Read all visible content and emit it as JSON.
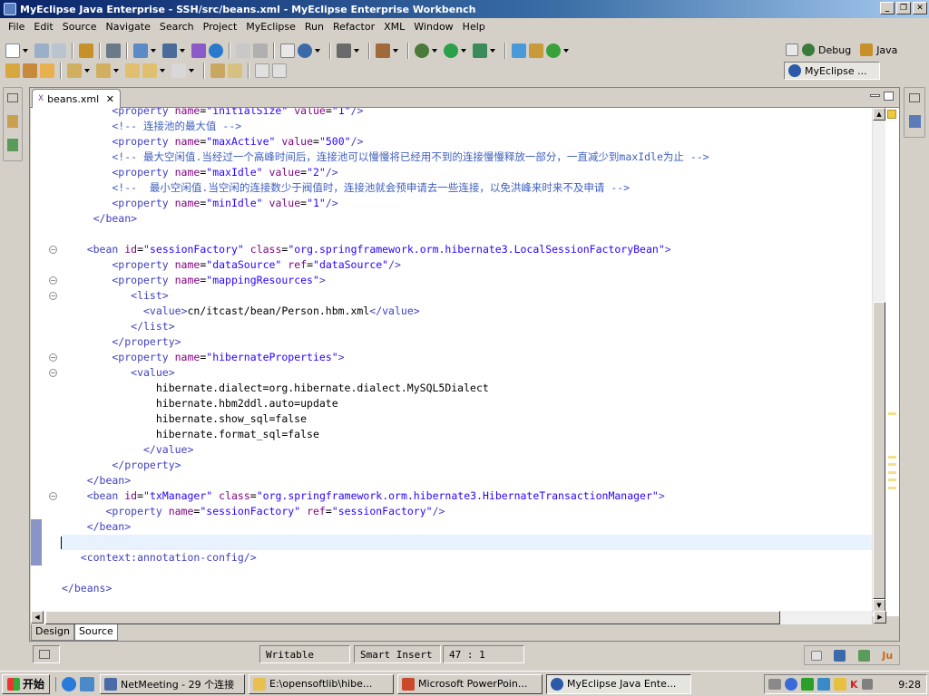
{
  "window": {
    "title": "MyEclipse Java Enterprise - SSH/src/beans.xml - MyEclipse Enterprise Workbench"
  },
  "menu": [
    "File",
    "Edit",
    "Source",
    "Navigate",
    "Search",
    "Project",
    "MyEclipse",
    "Run",
    "Refactor",
    "XML",
    "Window",
    "Help"
  ],
  "perspectives": {
    "debug": "Debug",
    "java": "Java",
    "myeclipse": "MyEclipse ..."
  },
  "editor": {
    "tab_label": "beans.xml",
    "bottom_tabs": [
      "Design",
      "Source"
    ],
    "lines": [
      {
        "fold": false,
        "segs": [
          {
            "c": "tg",
            "t": "        <property "
          },
          {
            "c": "at",
            "t": "name"
          },
          {
            "c": "tx",
            "t": "="
          },
          {
            "c": "av",
            "t": "\"initialSize\""
          },
          {
            "c": "tx",
            "t": " "
          },
          {
            "c": "at",
            "t": "value"
          },
          {
            "c": "tx",
            "t": "="
          },
          {
            "c": "av",
            "t": "\"1\""
          },
          {
            "c": "tg",
            "t": "/>"
          }
        ]
      },
      {
        "fold": false,
        "segs": [
          {
            "c": "cm",
            "t": "        <!-- 连接池的最大值 -->"
          }
        ]
      },
      {
        "fold": false,
        "segs": [
          {
            "c": "tg",
            "t": "        <property "
          },
          {
            "c": "at",
            "t": "name"
          },
          {
            "c": "tx",
            "t": "="
          },
          {
            "c": "av",
            "t": "\"maxActive\""
          },
          {
            "c": "tx",
            "t": " "
          },
          {
            "c": "at",
            "t": "value"
          },
          {
            "c": "tx",
            "t": "="
          },
          {
            "c": "av",
            "t": "\"500\""
          },
          {
            "c": "tg",
            "t": "/>"
          }
        ]
      },
      {
        "fold": false,
        "segs": [
          {
            "c": "cm",
            "t": "        <!-- 最大空闲值.当经过一个高峰时间后，连接池可以慢慢将已经用不到的连接慢慢释放一部分，一直减少到maxIdle为止 -->"
          }
        ]
      },
      {
        "fold": false,
        "segs": [
          {
            "c": "tg",
            "t": "        <property "
          },
          {
            "c": "at",
            "t": "name"
          },
          {
            "c": "tx",
            "t": "="
          },
          {
            "c": "av",
            "t": "\"maxIdle\""
          },
          {
            "c": "tx",
            "t": " "
          },
          {
            "c": "at",
            "t": "value"
          },
          {
            "c": "tx",
            "t": "="
          },
          {
            "c": "av",
            "t": "\"2\""
          },
          {
            "c": "tg",
            "t": "/>"
          }
        ]
      },
      {
        "fold": false,
        "segs": [
          {
            "c": "cm",
            "t": "        <!--  最小空闲值.当空闲的连接数少于阀值时，连接池就会预申请去一些连接，以免洪峰来时来不及申请 -->"
          }
        ]
      },
      {
        "fold": false,
        "segs": [
          {
            "c": "tg",
            "t": "        <property "
          },
          {
            "c": "at",
            "t": "name"
          },
          {
            "c": "tx",
            "t": "="
          },
          {
            "c": "av",
            "t": "\"minIdle\""
          },
          {
            "c": "tx",
            "t": " "
          },
          {
            "c": "at",
            "t": "value"
          },
          {
            "c": "tx",
            "t": "="
          },
          {
            "c": "av",
            "t": "\"1\""
          },
          {
            "c": "tg",
            "t": "/>"
          }
        ]
      },
      {
        "fold": false,
        "segs": [
          {
            "c": "tg",
            "t": "     </bean>"
          }
        ]
      },
      {
        "fold": false,
        "segs": [
          {
            "c": "tx",
            "t": ""
          }
        ]
      },
      {
        "fold": true,
        "segs": [
          {
            "c": "tg",
            "t": "    <bean "
          },
          {
            "c": "at",
            "t": "id"
          },
          {
            "c": "tx",
            "t": "="
          },
          {
            "c": "av",
            "t": "\"sessionFactory\""
          },
          {
            "c": "tx",
            "t": " "
          },
          {
            "c": "at",
            "t": "class"
          },
          {
            "c": "tx",
            "t": "="
          },
          {
            "c": "av",
            "t": "\"org.springframework.orm.hibernate3.LocalSessionFactoryBean\""
          },
          {
            "c": "tg",
            "t": ">"
          }
        ]
      },
      {
        "fold": false,
        "segs": [
          {
            "c": "tg",
            "t": "        <property "
          },
          {
            "c": "at",
            "t": "name"
          },
          {
            "c": "tx",
            "t": "="
          },
          {
            "c": "av",
            "t": "\"dataSource\""
          },
          {
            "c": "tx",
            "t": " "
          },
          {
            "c": "at",
            "t": "ref"
          },
          {
            "c": "tx",
            "t": "="
          },
          {
            "c": "av",
            "t": "\"dataSource\""
          },
          {
            "c": "tg",
            "t": "/>"
          }
        ]
      },
      {
        "fold": true,
        "segs": [
          {
            "c": "tg",
            "t": "        <property "
          },
          {
            "c": "at",
            "t": "name"
          },
          {
            "c": "tx",
            "t": "="
          },
          {
            "c": "av",
            "t": "\"mappingResources\""
          },
          {
            "c": "tg",
            "t": ">"
          }
        ]
      },
      {
        "fold": true,
        "segs": [
          {
            "c": "tg",
            "t": "           <list>"
          }
        ]
      },
      {
        "fold": false,
        "segs": [
          {
            "c": "tg",
            "t": "             <value>"
          },
          {
            "c": "tx",
            "t": "cn/itcast/bean/Person.hbm.xml"
          },
          {
            "c": "tg",
            "t": "</value>"
          }
        ]
      },
      {
        "fold": false,
        "segs": [
          {
            "c": "tg",
            "t": "           </list>"
          }
        ]
      },
      {
        "fold": false,
        "segs": [
          {
            "c": "tg",
            "t": "        </property>"
          }
        ]
      },
      {
        "fold": true,
        "segs": [
          {
            "c": "tg",
            "t": "        <property "
          },
          {
            "c": "at",
            "t": "name"
          },
          {
            "c": "tx",
            "t": "="
          },
          {
            "c": "av",
            "t": "\"hibernateProperties\""
          },
          {
            "c": "tg",
            "t": ">"
          }
        ]
      },
      {
        "fold": true,
        "segs": [
          {
            "c": "tg",
            "t": "           <value>"
          }
        ]
      },
      {
        "fold": false,
        "segs": [
          {
            "c": "tx",
            "t": "               hibernate.dialect=org.hibernate.dialect.MySQL5Dialect"
          }
        ]
      },
      {
        "fold": false,
        "segs": [
          {
            "c": "tx",
            "t": "               hibernate.hbm2ddl.auto=update"
          }
        ]
      },
      {
        "fold": false,
        "segs": [
          {
            "c": "tx",
            "t": "               hibernate.show_sql=false"
          }
        ]
      },
      {
        "fold": false,
        "segs": [
          {
            "c": "tx",
            "t": "               hibernate.format_sql=false"
          }
        ]
      },
      {
        "fold": false,
        "segs": [
          {
            "c": "tg",
            "t": "             </value>"
          }
        ]
      },
      {
        "fold": false,
        "segs": [
          {
            "c": "tg",
            "t": "        </property>"
          }
        ]
      },
      {
        "fold": false,
        "segs": [
          {
            "c": "tg",
            "t": "    </bean>"
          }
        ]
      },
      {
        "fold": true,
        "segs": [
          {
            "c": "tg",
            "t": "    <bean "
          },
          {
            "c": "at",
            "t": "id"
          },
          {
            "c": "tx",
            "t": "="
          },
          {
            "c": "av",
            "t": "\"txManager\""
          },
          {
            "c": "tx",
            "t": " "
          },
          {
            "c": "at",
            "t": "class"
          },
          {
            "c": "tx",
            "t": "="
          },
          {
            "c": "av",
            "t": "\"org.springframework.orm.hibernate3.HibernateTransactionManager\""
          },
          {
            "c": "tg",
            "t": ">"
          }
        ]
      },
      {
        "fold": false,
        "segs": [
          {
            "c": "tg",
            "t": "       <property "
          },
          {
            "c": "at",
            "t": "name"
          },
          {
            "c": "tx",
            "t": "="
          },
          {
            "c": "av",
            "t": "\"sessionFactory\""
          },
          {
            "c": "tx",
            "t": " "
          },
          {
            "c": "at",
            "t": "ref"
          },
          {
            "c": "tx",
            "t": "="
          },
          {
            "c": "av",
            "t": "\"sessionFactory\""
          },
          {
            "c": "tg",
            "t": "/>"
          }
        ]
      },
      {
        "fold": false,
        "segs": [
          {
            "c": "tg",
            "t": "    </bean>"
          }
        ]
      },
      {
        "fold": false,
        "current": true,
        "segs": [
          {
            "c": "tx",
            "t": ""
          }
        ]
      },
      {
        "fold": false,
        "segs": [
          {
            "c": "tg",
            "t": "   <context:annotation-config/>"
          }
        ]
      },
      {
        "fold": false,
        "segs": [
          {
            "c": "tx",
            "t": ""
          }
        ]
      },
      {
        "fold": false,
        "segs": [
          {
            "c": "tg",
            "t": "</beans>"
          }
        ]
      }
    ]
  },
  "status": {
    "writable": "Writable",
    "insert_mode": "Smart Insert",
    "position": "47 : 1"
  },
  "taskbar": {
    "start": "开始",
    "tasks": [
      "NetMeeting - 29 个连接",
      "E:\\opensoftlib\\hibe...",
      "Microsoft PowerPoin...",
      "MyEclipse Java Ente..."
    ],
    "clock": "9:28"
  }
}
